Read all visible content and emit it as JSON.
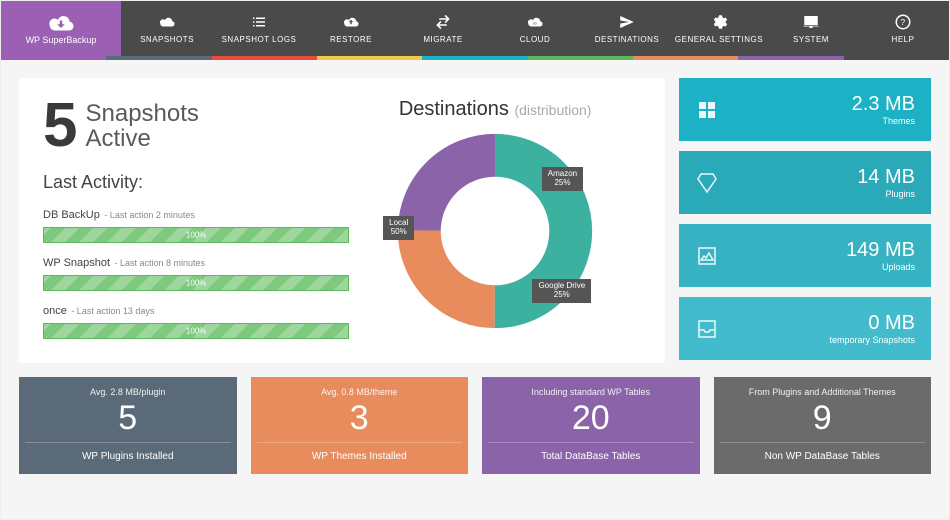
{
  "brand": "WP SuperBackup",
  "nav": {
    "items": [
      {
        "label": "SNAPSHOTS",
        "icon": "cloud"
      },
      {
        "label": "SNAPSHOT LOGS",
        "icon": "list"
      },
      {
        "label": "RESTORE",
        "icon": "cloud-up"
      },
      {
        "label": "MIGRATE",
        "icon": "transfer"
      },
      {
        "label": "CLOUD",
        "icon": "cloud-inf"
      },
      {
        "label": "DESTINATIONS",
        "icon": "send"
      },
      {
        "label": "GENERAL SETTINGS",
        "icon": "gear"
      },
      {
        "label": "SYSTEM",
        "icon": "monitor"
      },
      {
        "label": "HELP",
        "icon": "help"
      }
    ]
  },
  "strip_colors": [
    "#9b5fb4",
    "#5a6a78",
    "#7ec97e",
    "#e88b5d",
    "#f2c94c",
    "#1cb1c4",
    "#8a63a8",
    "#6b6b6b",
    "#4a4a4a"
  ],
  "snapshots": {
    "count": "5",
    "line1": "Snapshots",
    "line2": "Active"
  },
  "activity": {
    "heading": "Last Activity:",
    "rows": [
      {
        "name": "DB BackUp",
        "sub": "- Last action 2 minutes",
        "pct": "100%"
      },
      {
        "name": "WP Snapshot",
        "sub": "- Last action 8 minutes",
        "pct": "100%"
      },
      {
        "name": "once",
        "sub": "- Last action 13 days",
        "pct": "100%"
      }
    ]
  },
  "donut": {
    "title": "Destinations",
    "sub": "(distribution)",
    "local": {
      "label": "Local",
      "pct": "50%"
    },
    "amazon": {
      "label": "Amazon",
      "pct": "25%"
    },
    "gdrive": {
      "label": "Google Drive",
      "pct": "25%"
    }
  },
  "chart_data": {
    "type": "pie",
    "title": "Destinations (distribution)",
    "series": [
      {
        "name": "Local",
        "value": 50,
        "color": "#3cb1a0"
      },
      {
        "name": "Amazon",
        "value": 25,
        "color": "#e88b5d"
      },
      {
        "name": "Google Drive",
        "value": 25,
        "color": "#8a63a8"
      }
    ]
  },
  "stats": [
    {
      "val": "2.3 MB",
      "lab": "Themes",
      "icon": "grid"
    },
    {
      "val": "14 MB",
      "lab": "Plugins",
      "icon": "diamond"
    },
    {
      "val": "149 MB",
      "lab": "Uploads",
      "icon": "image"
    },
    {
      "val": "0 MB",
      "lab": "temporary Snapshots",
      "icon": "inbox"
    }
  ],
  "bottom": [
    {
      "avg": "Avg. 2.8 MB/plugin",
      "num": "5",
      "lab": "WP Plugins Installed"
    },
    {
      "avg": "Avg. 0.8 MB/theme",
      "num": "3",
      "lab": "WP Themes Installed"
    },
    {
      "avg": "Including standard WP Tables",
      "num": "20",
      "lab": "Total DataBase Tables"
    },
    {
      "avg": "From Plugins and Additional Themes",
      "num": "9",
      "lab": "Non WP DataBase Tables"
    }
  ]
}
